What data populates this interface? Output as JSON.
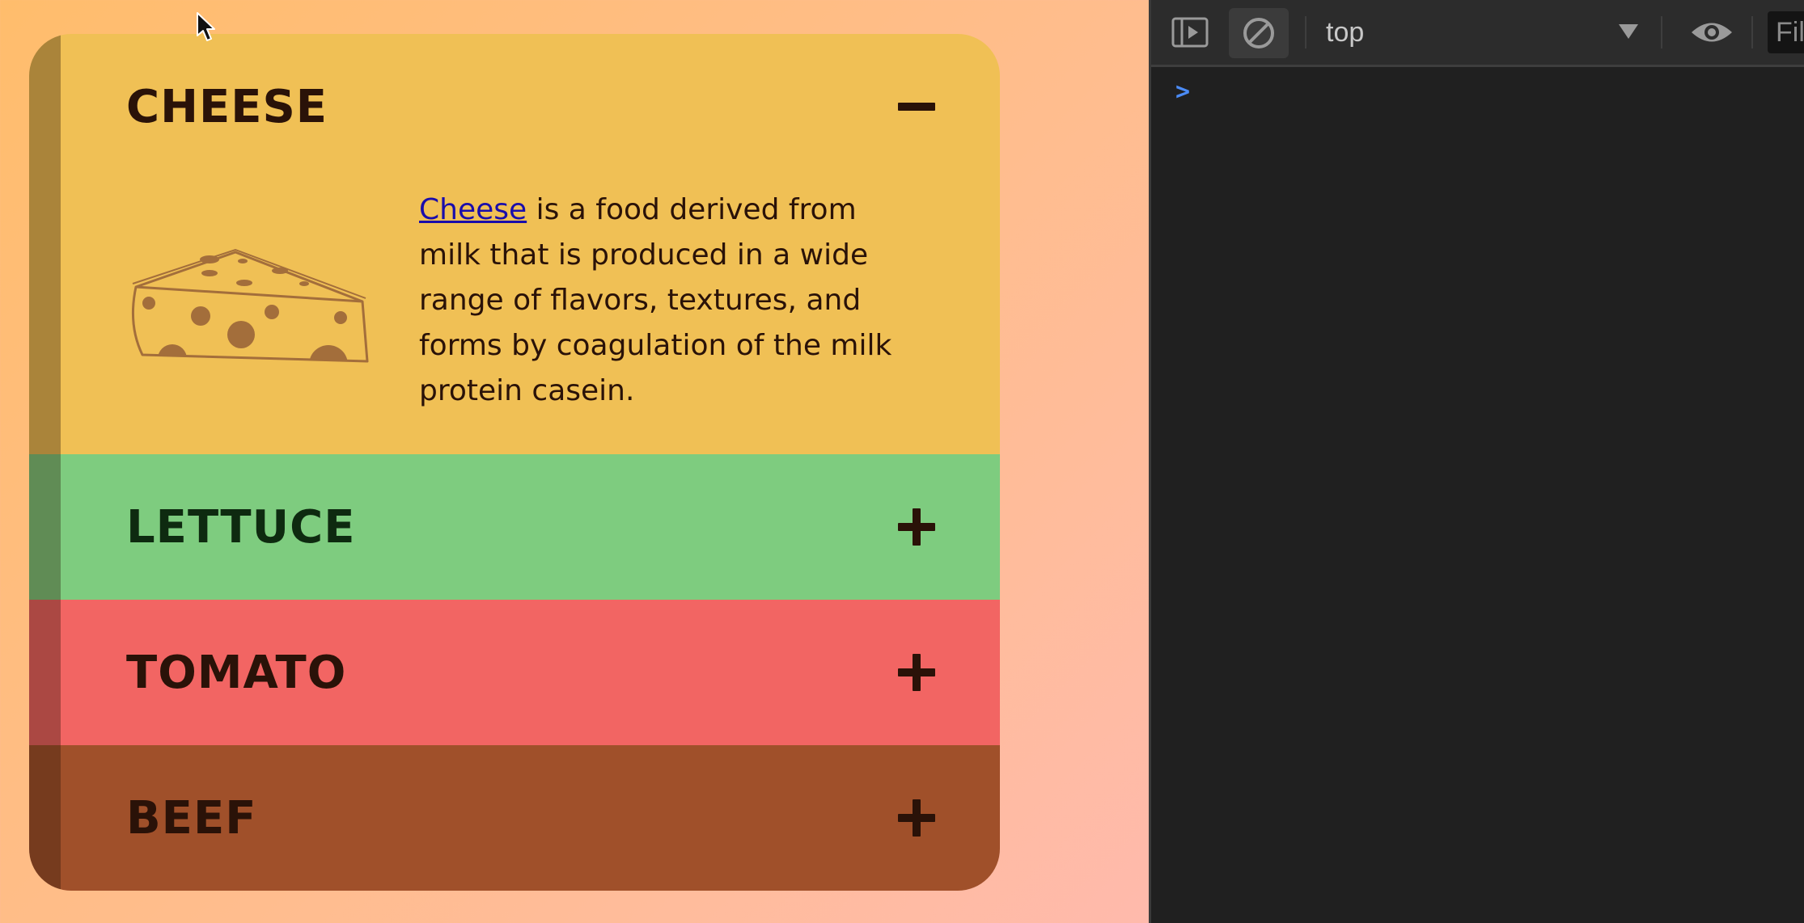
{
  "accordion": {
    "panels": [
      {
        "title": "CHEESE",
        "expanded": true,
        "toggle_icon": "minus-icon",
        "color": "#f0c055",
        "illustration": "cheese-wedge-icon",
        "link_text": "Cheese",
        "body_text": " is a food derived from milk that is produced in a wide range of flavors, textures, and forms by coagulation of the milk protein casein."
      },
      {
        "title": "LETTUCE",
        "expanded": false,
        "toggle_icon": "plus-icon",
        "color": "#7ecc7f"
      },
      {
        "title": "TOMATO",
        "expanded": false,
        "toggle_icon": "plus-icon",
        "color": "#f26563"
      },
      {
        "title": "BEEF",
        "expanded": false,
        "toggle_icon": "plus-icon",
        "color": "#a0502a"
      }
    ]
  },
  "devtools": {
    "dock_icon": "dock-side-icon",
    "clear_icon": "clear-console-icon",
    "context_label": "top",
    "context_dropdown_icon": "triangle-down-icon",
    "live_expression_icon": "eye-icon",
    "filter_placeholder": "Filter",
    "prompt_icon": "chevron-right-icon",
    "accent": "#4b8bf5"
  }
}
